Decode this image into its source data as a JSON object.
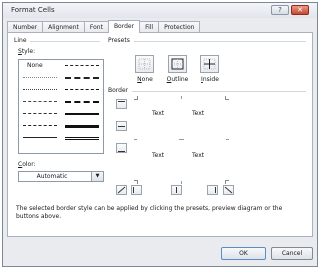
{
  "window": {
    "title": "Format Cells",
    "help_glyph": "?",
    "close_glyph": "✕"
  },
  "tabs": [
    "Number",
    "Alignment",
    "Font",
    "Border",
    "Fill",
    "Protection"
  ],
  "active_tab": "Border",
  "line_group": {
    "title": "Line",
    "style_label": "Style:",
    "none_label": "None",
    "color_label": "Color:",
    "color_value": "Automatic"
  },
  "presets_group": {
    "title": "Presets",
    "items": [
      "None",
      "Outline",
      "Inside"
    ]
  },
  "border_group": {
    "title": "Border"
  },
  "preview": {
    "cells": [
      "Text",
      "Text",
      "Text",
      "Text"
    ]
  },
  "description": "The selected border style can be applied by clicking the presets, preview diagram or the buttons above.",
  "buttons": {
    "ok": "OK",
    "cancel": "Cancel"
  }
}
